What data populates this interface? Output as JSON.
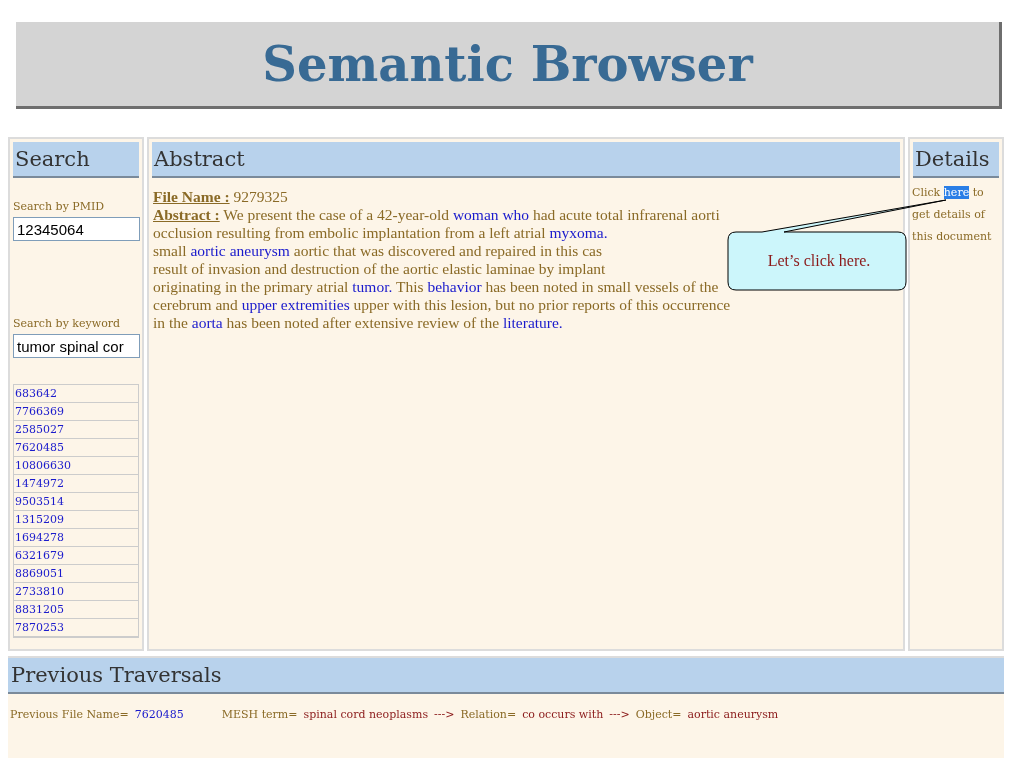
{
  "title": "Semantic Browser",
  "search": {
    "heading": "Search",
    "pmid_label": "Search by PMID",
    "pmid_value": "12345064",
    "keyword_label": "Search by keyword",
    "keyword_value": "tumor spinal cor",
    "results": [
      "683642",
      "7766369",
      "2585027",
      "7620485",
      "10806630",
      "1474972",
      "9503514",
      "1315209",
      "1694278",
      "6321679",
      "8869051",
      "2733810",
      "8831205",
      "7870253"
    ]
  },
  "abstract": {
    "heading": "Abstract",
    "file_label": "File Name :",
    "file_value": "9279325",
    "abstract_label": "Abstract :",
    "lines": [
      [
        {
          "kind": "text",
          "text": "We present the case of a 42-year-old "
        },
        {
          "kind": "link",
          "text": "woman who"
        },
        {
          "kind": "text",
          "text": " had acute total infrarenal aorti"
        }
      ],
      [
        {
          "kind": "text",
          "text": "occlusion resulting from embolic implantation from a left atrial "
        },
        {
          "kind": "link",
          "text": "myxoma."
        }
      ],
      [
        {
          "kind": "text",
          "text": "small "
        },
        {
          "kind": "link",
          "text": "aortic aneurysm"
        },
        {
          "kind": "text",
          "text": " aortic that was discovered and repaired in this cas"
        }
      ],
      [
        {
          "kind": "text",
          "text": "result of invasion and destruction of the aortic elastic laminae by implant"
        }
      ],
      [
        {
          "kind": "text",
          "text": "originating in the primary atrial "
        },
        {
          "kind": "link",
          "text": "tumor."
        },
        {
          "kind": "text",
          "text": " This "
        },
        {
          "kind": "link",
          "text": "behavior"
        },
        {
          "kind": "text",
          "text": " has been noted in small vessels of the"
        }
      ],
      [
        {
          "kind": "text",
          "text": "cerebrum and "
        },
        {
          "kind": "link",
          "text": "upper extremities"
        },
        {
          "kind": "text",
          "text": " upper with this lesion, but no prior reports of this occurrence"
        }
      ],
      [
        {
          "kind": "text",
          "text": "in the "
        },
        {
          "kind": "link",
          "text": "aorta"
        },
        {
          "kind": "text",
          "text": " has been noted after extensive review of the "
        },
        {
          "kind": "link",
          "text": "literature."
        }
      ]
    ]
  },
  "details": {
    "heading": "Details",
    "before": "Click",
    "link": "here",
    "link_selected": true,
    "after": "to get details of this document"
  },
  "callout": {
    "text": "Let’s click here."
  },
  "traversals": {
    "heading": "Previous Traversals",
    "items": [
      {
        "kind": "label",
        "text": "Previous File Name="
      },
      {
        "kind": "link",
        "text": "7620485"
      },
      {
        "kind": "gap"
      },
      {
        "kind": "label",
        "text": "MESH term="
      },
      {
        "kind": "value",
        "text": "spinal cord neoplasms"
      },
      {
        "kind": "arrow",
        "text": "--->"
      },
      {
        "kind": "label",
        "text": "Relation="
      },
      {
        "kind": "value",
        "text": "co occurs with"
      },
      {
        "kind": "arrow",
        "text": "--->"
      },
      {
        "kind": "label",
        "text": "Object="
      },
      {
        "kind": "value",
        "text": "aortic aneurysm"
      }
    ]
  }
}
